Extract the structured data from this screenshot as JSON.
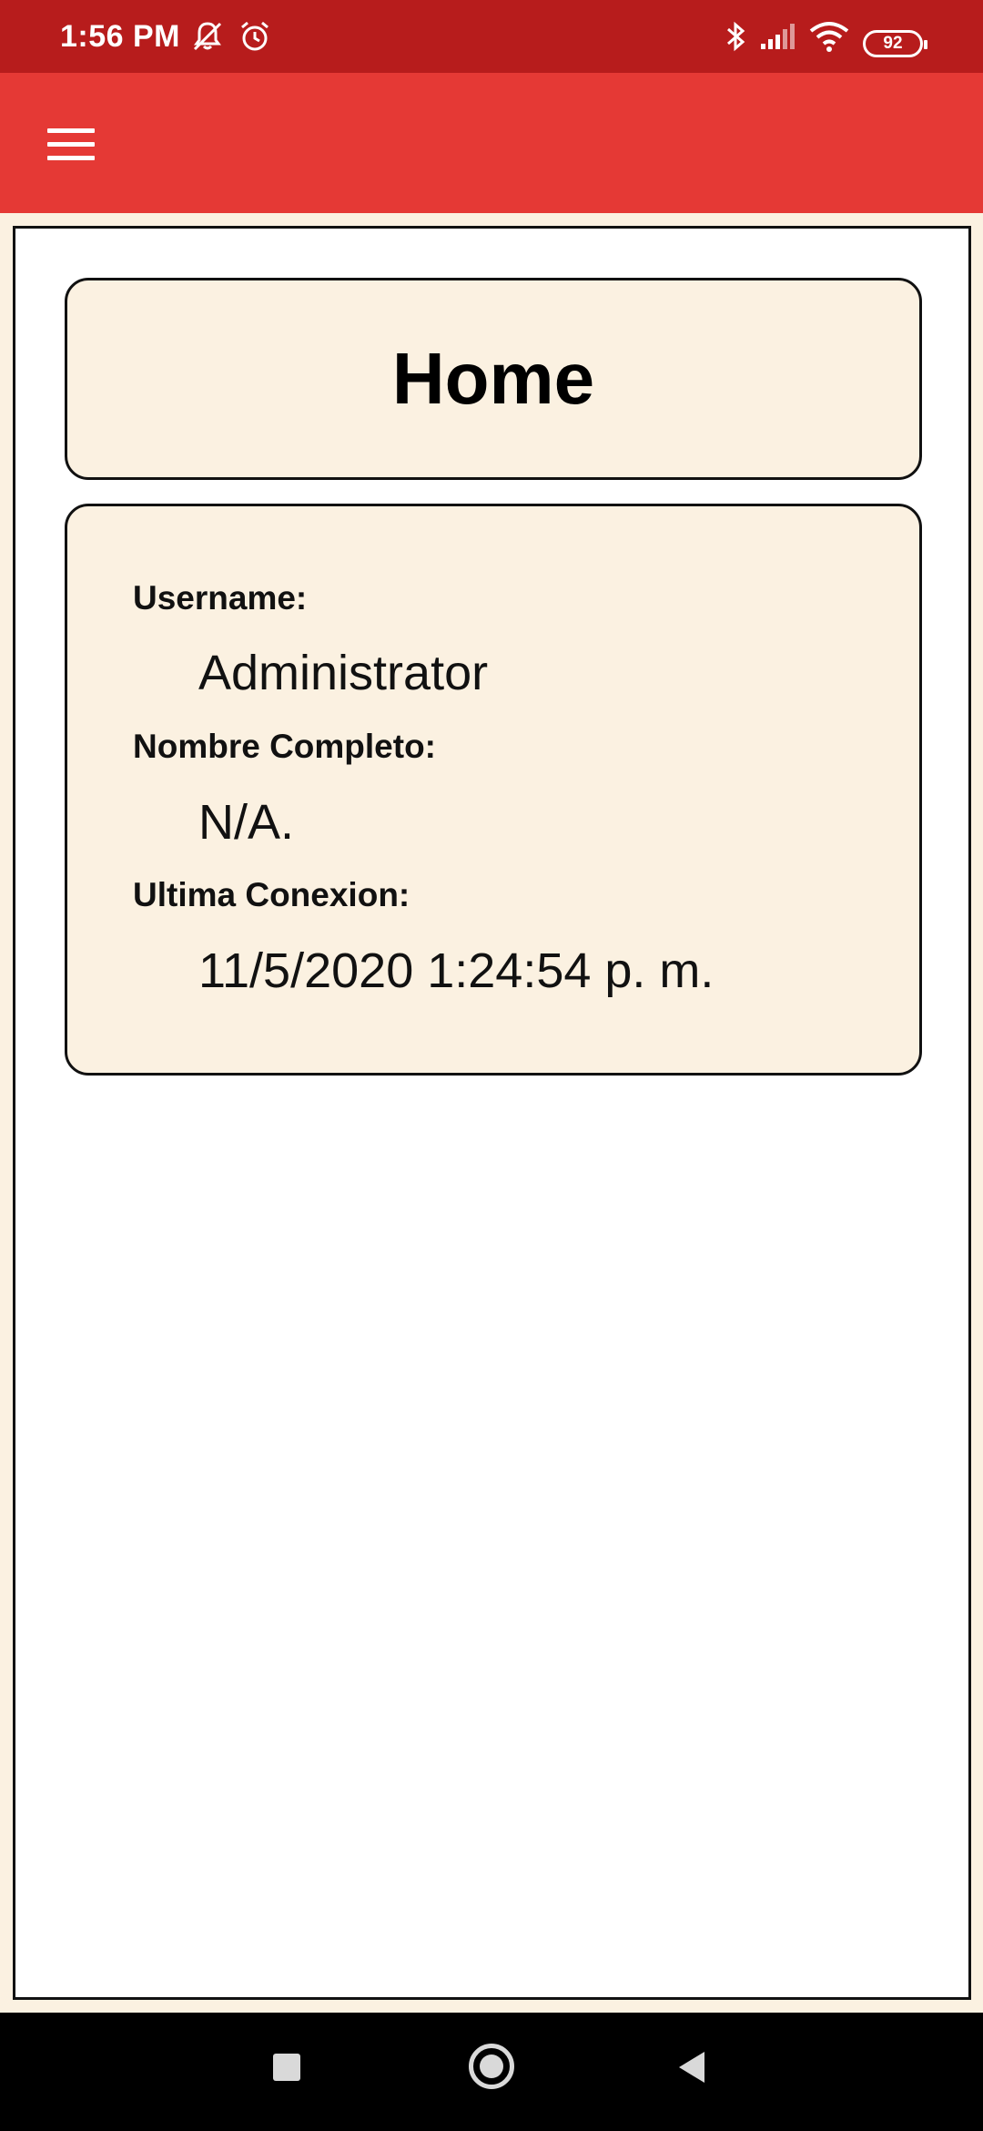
{
  "status_bar": {
    "time": "1:56 PM",
    "battery": "92",
    "icons": [
      "mute-icon",
      "alarm-icon",
      "bluetooth-icon",
      "signal-icon",
      "wifi-icon",
      "battery-icon"
    ]
  },
  "app_bar": {
    "menu_icon": "hamburger-menu-icon"
  },
  "home": {
    "title": "Home",
    "fields": {
      "username_label": "Username:",
      "username_value": "Administrator",
      "fullname_label": "Nombre Completo:",
      "fullname_value": "N/A.",
      "last_connection_label": "Ultima Conexion:",
      "last_connection_value": "11/5/2020 1:24:54 p. m."
    }
  },
  "colors": {
    "status_bar": "#b71c1c",
    "app_bar": "#e53935",
    "card_background": "#fbf1e1",
    "panel_background": "#ffffff"
  },
  "nav_bar": {
    "icons": [
      "recent-apps-icon",
      "home-icon",
      "back-icon"
    ]
  }
}
